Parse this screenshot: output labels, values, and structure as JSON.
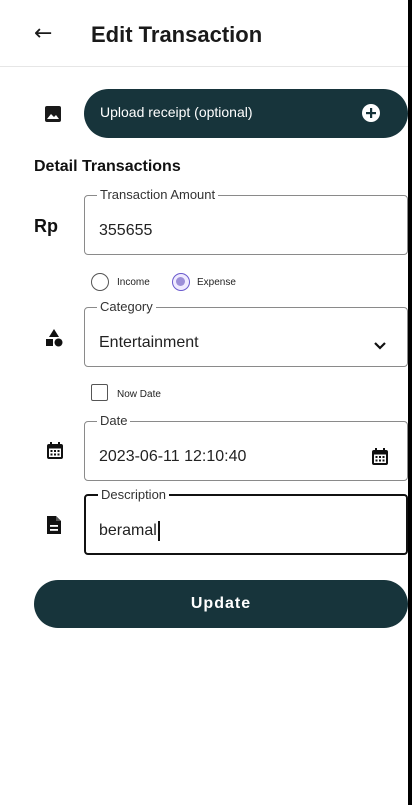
{
  "header": {
    "back_icon": "arrow-left-icon",
    "title": "Edit Transaction"
  },
  "upload": {
    "icon": "image-icon",
    "label": "Upload receipt (optional)",
    "action_icon": "plus-circle-icon"
  },
  "section": {
    "title": "Detail Transactions"
  },
  "amount": {
    "currency_label": "Rp",
    "label": "Transaction Amount",
    "value": "355655"
  },
  "type": {
    "options": [
      {
        "label": "Income",
        "selected": false
      },
      {
        "label": "Expense",
        "selected": true
      }
    ]
  },
  "category": {
    "icon": "shapes-icon",
    "label": "Category",
    "value": "Entertainment",
    "dropdown_icon": "chevron-down-icon"
  },
  "now_date": {
    "label": "Now Date",
    "checked": false
  },
  "date": {
    "icon": "calendar-icon",
    "label": "Date",
    "value": "2023-06-11 12:10:40"
  },
  "description": {
    "icon": "document-icon",
    "label": "Description",
    "value": "beramal"
  },
  "actions": {
    "update_label": "Update"
  },
  "colors": {
    "primary": "#17343b",
    "radio_accent": "#6a5acd"
  }
}
